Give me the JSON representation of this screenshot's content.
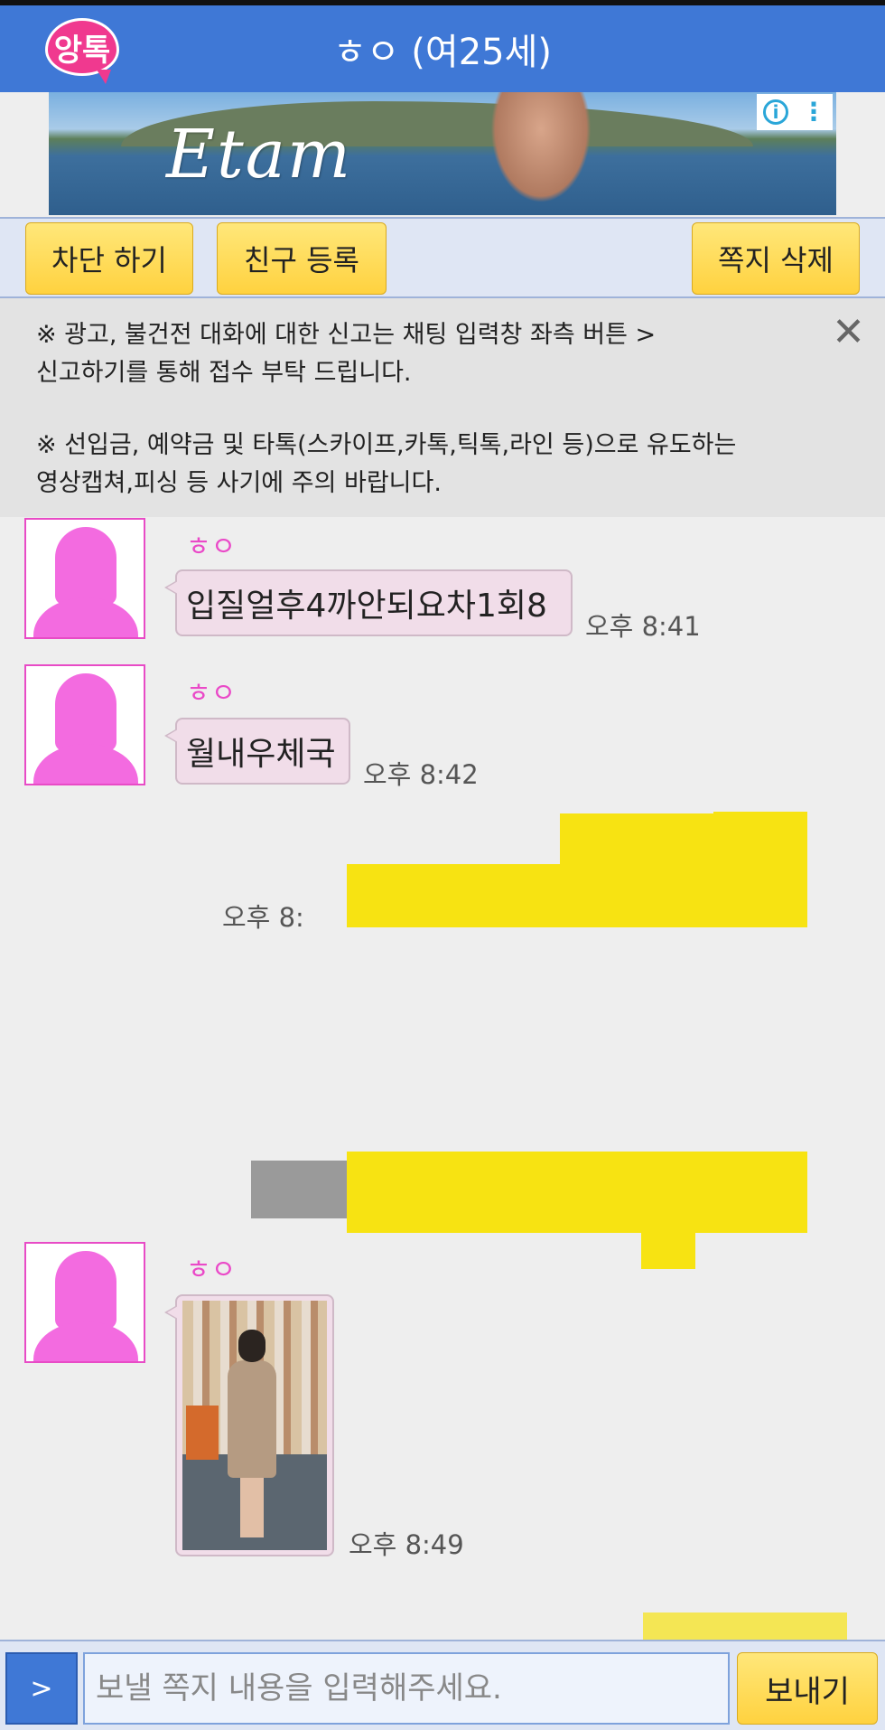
{
  "header": {
    "logo_text": "앙톡",
    "title": "ㅎㅇ (여25세)"
  },
  "ad": {
    "brand": "Etam",
    "info_icon": "info-icon",
    "menu_icon": "more-vert-icon"
  },
  "actions": {
    "block": "차단 하기",
    "add_friend": "친구 등록",
    "delete_message": "쪽지 삭제"
  },
  "notice": {
    "line1": "※ 광고, 불건전 대화에 대한 신고는 채팅 입력창 좌측 버튼 >",
    "line2": "신고하기를 통해 접수 부탁 드립니다.",
    "line3": "※ 선입금, 예약금 및 타톡(스카이프,카톡,틱톡,라인 등)으로 유도하는",
    "line4": "영상캡쳐,피싱 등 사기에 주의 바랍니다.",
    "close_icon": "close-icon"
  },
  "messages": [
    {
      "sender": "ㅎㅇ",
      "text": "입질얼후4까안되요차1회8",
      "time": "오후 8:41"
    },
    {
      "sender": "ㅎㅇ",
      "text": "월내우체국",
      "time": "오후 8:42"
    },
    {
      "outgoing": true,
      "time": "오후 8:"
    },
    {
      "sender": "ㅎㅇ",
      "image": "photo",
      "time": "오후 8:49"
    }
  ],
  "input": {
    "toggle": ">",
    "placeholder": "보낼 쪽지 내용을 입력해주세요.",
    "send": "보내기"
  },
  "colors": {
    "header": "#3f78d6",
    "accent_yellow": "#ffd23f",
    "sender_pink": "#ea49c8",
    "bubble": "#f1dde9"
  }
}
